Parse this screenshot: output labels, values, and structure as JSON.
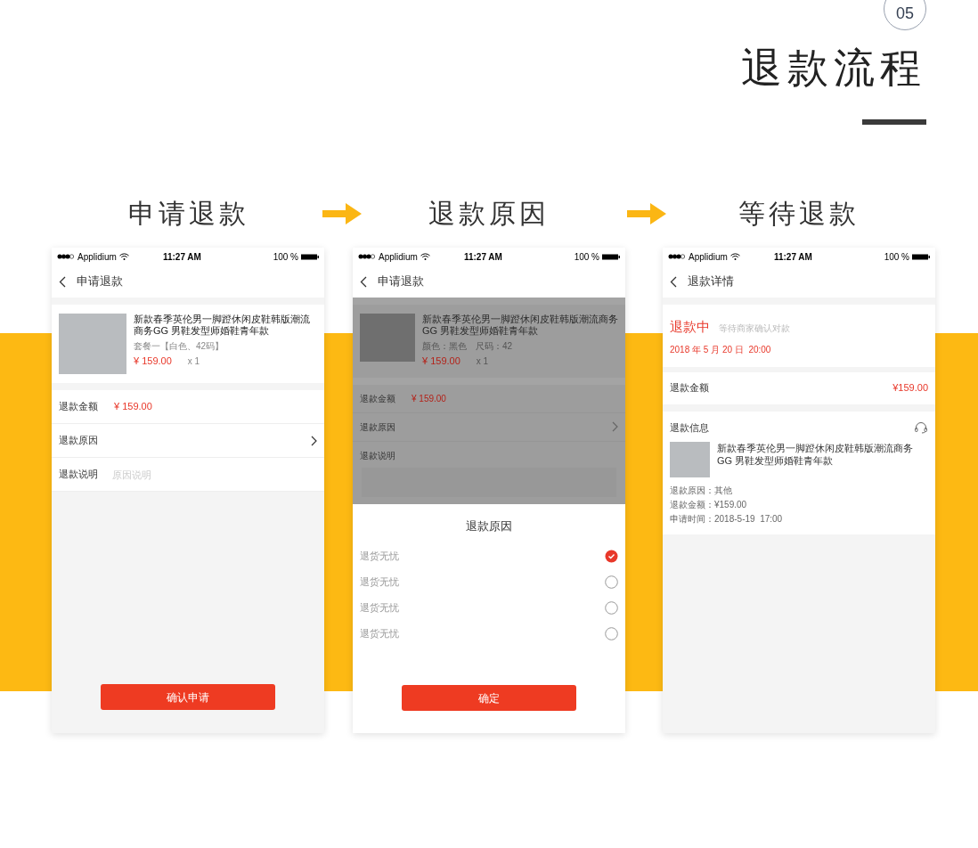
{
  "page_number": "05",
  "title": "退款流程",
  "steps": [
    {
      "label": "申请退款"
    },
    {
      "label": "退款原因"
    },
    {
      "label": "等待退款"
    }
  ],
  "screens": [
    {
      "kind": "form",
      "dimmed": false,
      "status_bar": {
        "carrier": "Applidium",
        "time": "11:27 AM",
        "battery": "100 %"
      },
      "nav_title": "申请退款",
      "product": {
        "name": "新款春季英伦男一脚蹬休闲皮鞋韩版潮流商务GG 男鞋发型师婚鞋青年款",
        "variant": "套餐一【白色、42码】",
        "price": "¥ 159.00",
        "quantity": "x 1"
      },
      "fields": [
        {
          "kind": "value",
          "label": "退款金额",
          "value": "¥ 159.00"
        },
        {
          "kind": "link",
          "label": "退款原因"
        },
        {
          "kind": "input",
          "label": "退款说明",
          "placeholder": "原因说明"
        }
      ],
      "button": "确认申请"
    },
    {
      "kind": "form",
      "dimmed": true,
      "status_bar": {
        "carrier": "Applidium",
        "time": "11:27 AM",
        "battery": "100 %"
      },
      "nav_title": "申请退款",
      "product": {
        "name": "新款春季英伦男一脚蹬休闲皮鞋韩版潮流商务GG 男鞋发型师婚鞋青年款",
        "variant": "颜色：黑色　尺码：42",
        "price": "¥ 159.00",
        "quantity": "x 1"
      },
      "fields": [
        {
          "kind": "value",
          "label": "退款金额",
          "value": "¥ 159.00"
        },
        {
          "kind": "link",
          "label": "退款原因"
        },
        {
          "kind": "textarea",
          "label": "退款说明"
        }
      ],
      "sheet": {
        "title": "退款原因",
        "options": [
          {
            "label": "退货无忧",
            "selected": true
          },
          {
            "label": "退货无忧",
            "selected": false
          },
          {
            "label": "退货无忧",
            "selected": false
          },
          {
            "label": "退货无忧",
            "selected": false
          }
        ],
        "button": "确定"
      }
    },
    {
      "kind": "detail",
      "status_bar": {
        "carrier": "Applidium",
        "time": "11:27 AM",
        "battery": "100 %"
      },
      "nav_title": "退款详情",
      "status": {
        "label": "退款中",
        "note": "等待商家确认对款",
        "time": "2018 年 5 月 20 日  20:00"
      },
      "amount": {
        "label": "退款金额",
        "value": "¥159.00"
      },
      "info": {
        "title": "退款信息",
        "product_name": "新款春季英伦男一脚蹬休闲皮鞋韩版潮流商务GG 男鞋发型师婚鞋青年款",
        "lines": [
          "退款原因：其他",
          "退款金额：¥159.00",
          "申请时间：2018-5-19  17:00"
        ]
      }
    }
  ]
}
